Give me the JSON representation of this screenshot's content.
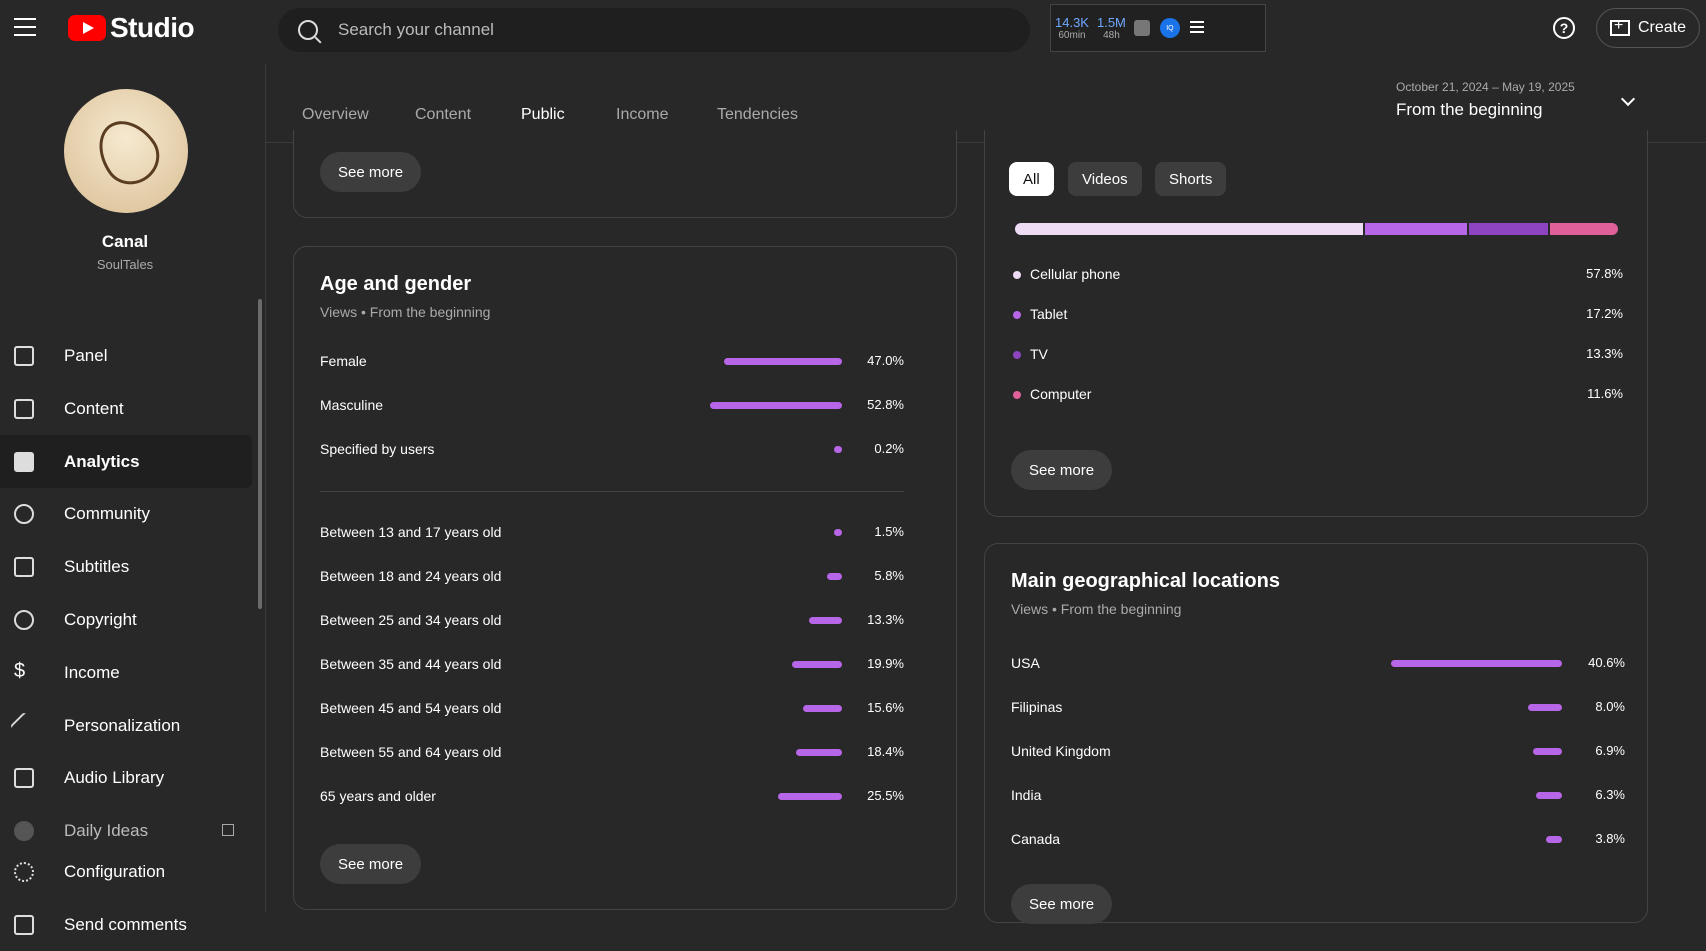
{
  "topbar": {
    "brand": "Studio",
    "search_placeholder": "Search your channel",
    "stats": [
      {
        "value": "14.3K",
        "sub": "60min"
      },
      {
        "value": "1.5M",
        "sub": "48h"
      }
    ],
    "iq_label": "IQ",
    "help": "?",
    "create_label": "Create"
  },
  "sidebar": {
    "channel_name": "Canal",
    "channel_handle": "SoulTales",
    "items": [
      {
        "label": "Panel",
        "icon": "dashboard-icon"
      },
      {
        "label": "Content",
        "icon": "content-icon"
      },
      {
        "label": "Analytics",
        "icon": "analytics-icon",
        "active": true
      },
      {
        "label": "Community",
        "icon": "community-icon"
      },
      {
        "label": "Subtitles",
        "icon": "subtitles-icon"
      },
      {
        "label": "Copyright",
        "icon": "copyright-icon"
      },
      {
        "label": "Income",
        "icon": "income-icon"
      },
      {
        "label": "Personalization",
        "icon": "personalization-icon"
      },
      {
        "label": "Audio Library",
        "icon": "audio-library-icon"
      },
      {
        "label": "Daily Ideas",
        "icon": "daily-ideas-icon"
      },
      {
        "label": "Configuration",
        "icon": "gear-icon"
      },
      {
        "label": "Send comments",
        "icon": "feedback-icon"
      }
    ]
  },
  "tabs": [
    "Overview",
    "Content",
    "Public",
    "Income",
    "Tendencies"
  ],
  "active_tab": "Public",
  "daterange": {
    "dates": "October 21, 2024 – May 19, 2025",
    "period": "From the beginning"
  },
  "top_card": {
    "see_more": "See more"
  },
  "age_gender": {
    "title": "Age and gender",
    "subtitle": "Views • From the beginning",
    "gender": [
      {
        "label": "Female",
        "value": "47.0%",
        "fraction": 0.47
      },
      {
        "label": "Masculine",
        "value": "52.8%",
        "fraction": 0.528
      },
      {
        "label": "Specified by users",
        "value": "0.2%",
        "fraction": 0.002
      }
    ],
    "age": [
      {
        "label": "Between 13 and 17 years old",
        "value": "1.5%",
        "fraction": 0.015
      },
      {
        "label": "Between 18 and 24 years old",
        "value": "5.8%",
        "fraction": 0.058
      },
      {
        "label": "Between 25 and 34 years old",
        "value": "13.3%",
        "fraction": 0.133
      },
      {
        "label": "Between 35 and 44 years old",
        "value": "19.9%",
        "fraction": 0.199
      },
      {
        "label": "Between 45 and 54 years old",
        "value": "15.6%",
        "fraction": 0.156
      },
      {
        "label": "Between 55 and 64 years old",
        "value": "18.4%",
        "fraction": 0.184
      },
      {
        "label": "65 years and older",
        "value": "25.5%",
        "fraction": 0.255
      }
    ],
    "see_more": "See more"
  },
  "devices": {
    "chips": [
      "All",
      "Videos",
      "Shorts"
    ],
    "active_chip": "All",
    "items": [
      {
        "label": "Cellular phone",
        "value": "57.8%",
        "fraction": 0.578,
        "color": "#eedcf5"
      },
      {
        "label": "Tablet",
        "value": "17.2%",
        "fraction": 0.172,
        "color": "#b866e8"
      },
      {
        "label": "TV",
        "value": "13.3%",
        "fraction": 0.133,
        "color": "#8e44c1"
      },
      {
        "label": "Computer",
        "value": "11.6%",
        "fraction": 0.116,
        "color": "#e0609a"
      }
    ],
    "see_more": "See more"
  },
  "geo": {
    "title": "Main geographical locations",
    "subtitle": "Views • From the beginning",
    "items": [
      {
        "label": "USA",
        "value": "40.6%",
        "fraction": 0.406
      },
      {
        "label": "Filipinas",
        "value": "8.0%",
        "fraction": 0.08
      },
      {
        "label": "United Kingdom",
        "value": "6.9%",
        "fraction": 0.069
      },
      {
        "label": "India",
        "value": "6.3%",
        "fraction": 0.063
      },
      {
        "label": "Canada",
        "value": "3.8%",
        "fraction": 0.038
      }
    ],
    "see_more": "See more"
  },
  "colors": {
    "bar": "#b866e8"
  }
}
